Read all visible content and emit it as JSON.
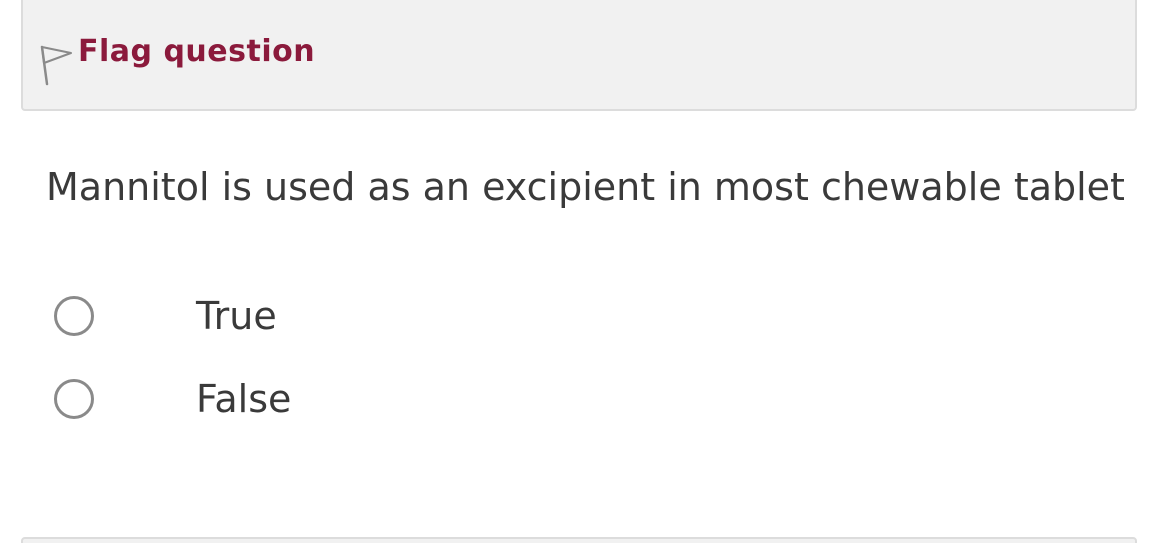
{
  "info": {
    "flag_label": "Flag question",
    "flag_icon": "flag-outline-icon",
    "link_color": "#8b1a3c",
    "background_color": "#f1f1f1"
  },
  "question": {
    "text": "Mannitol is used as an excipient in most chewable tablet"
  },
  "answers": [
    {
      "label": "True",
      "selected": false
    },
    {
      "label": "False",
      "selected": false
    }
  ]
}
